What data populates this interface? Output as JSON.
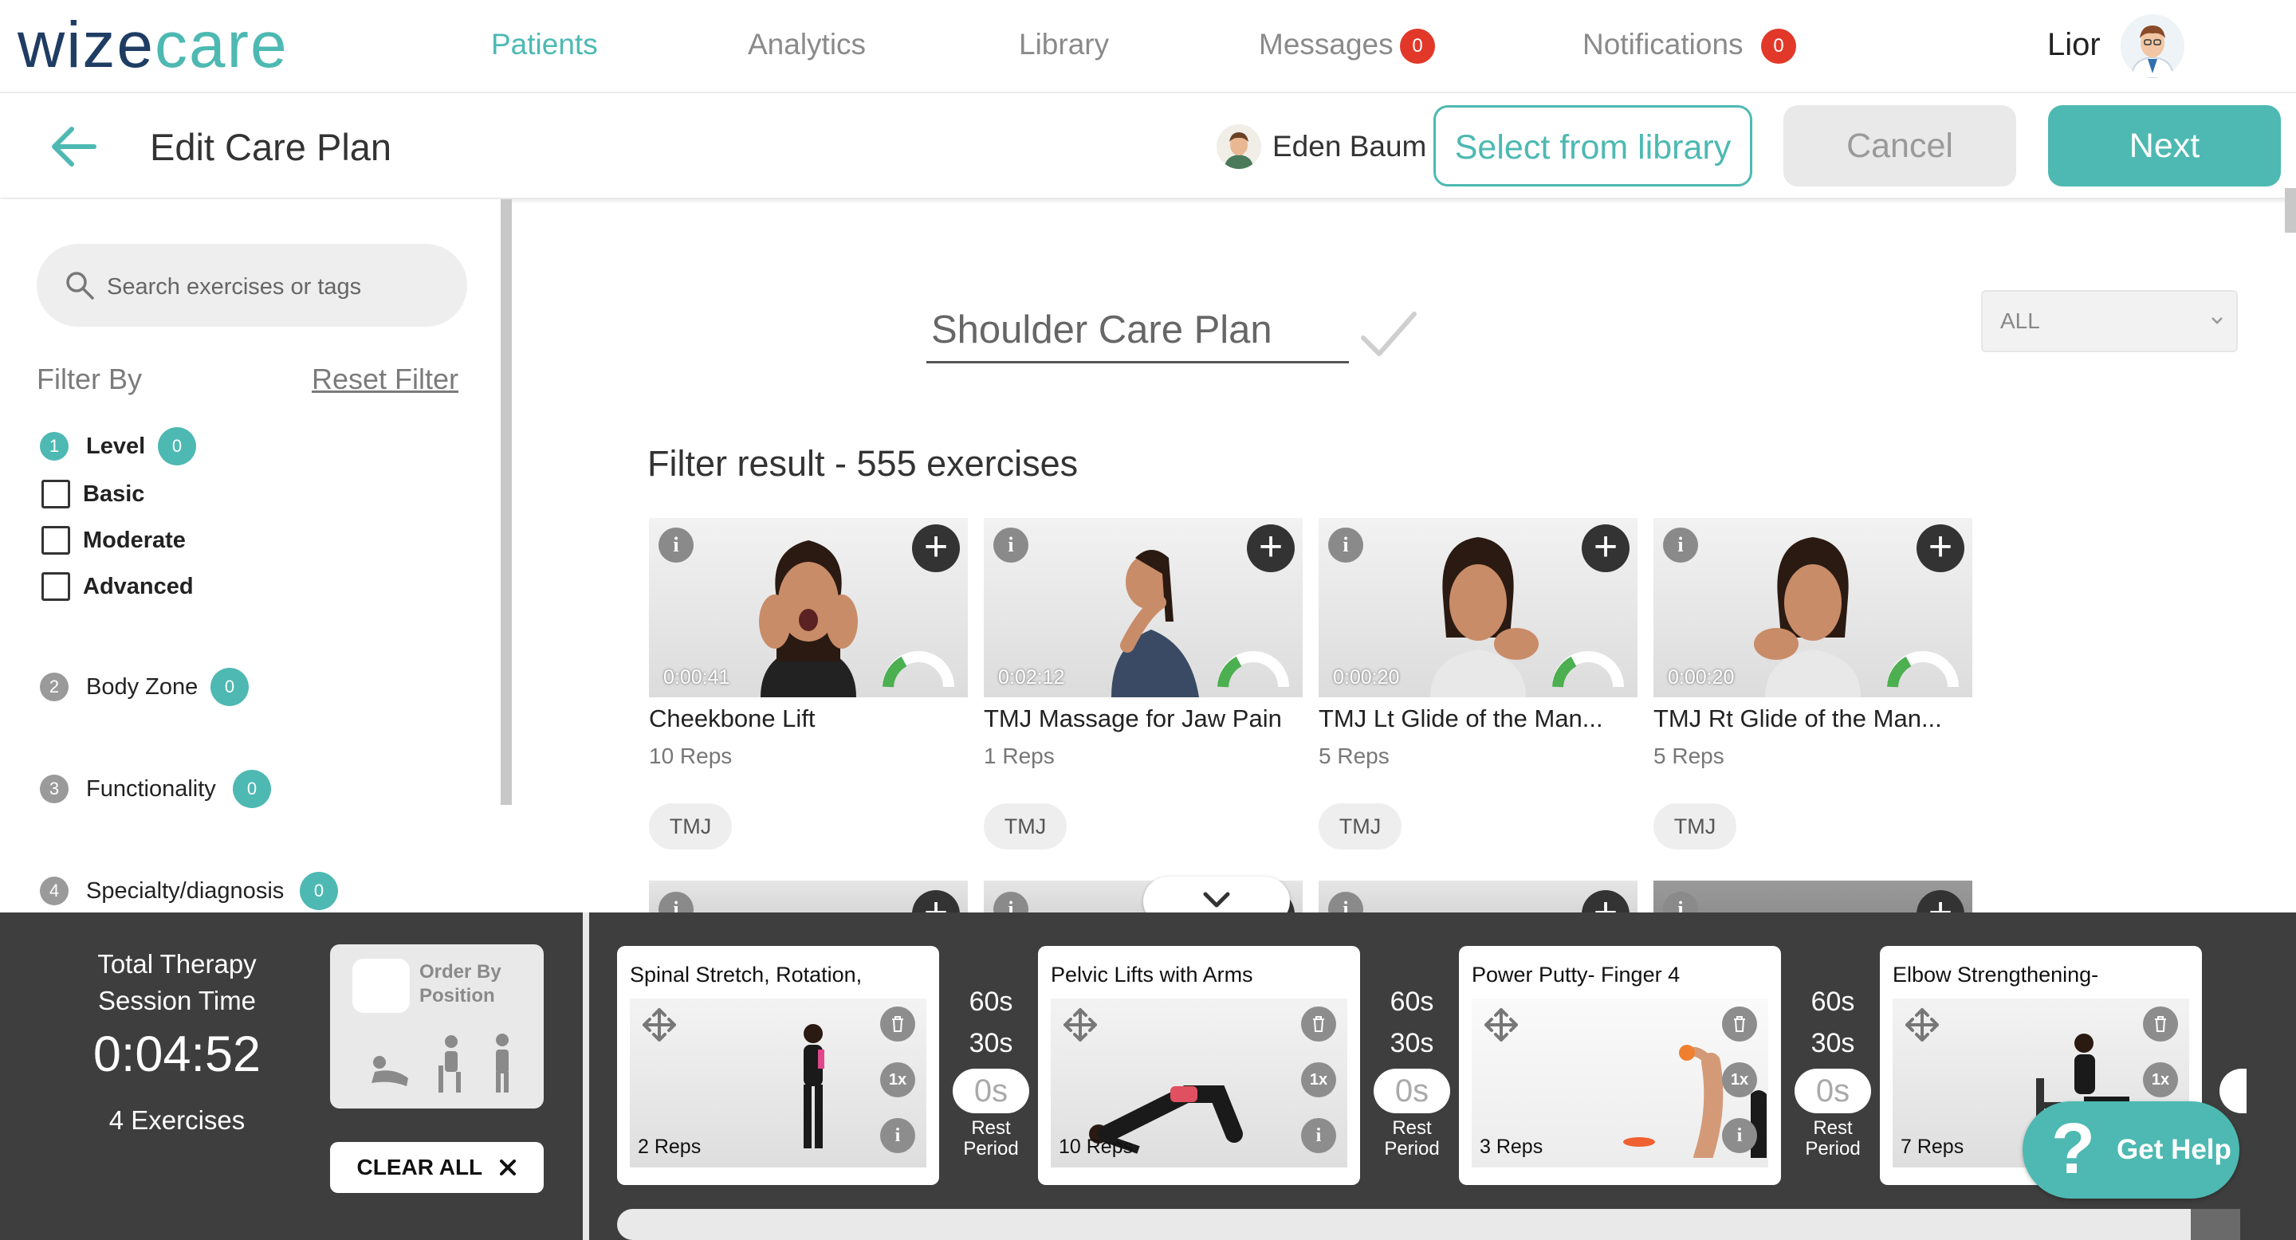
{
  "nav": {
    "logo_part1": "wize",
    "logo_part2": "care",
    "items": [
      {
        "label": "Patients"
      },
      {
        "label": "Analytics"
      },
      {
        "label": "Library"
      },
      {
        "label": "Messages",
        "badge": "0"
      },
      {
        "label": "Notifications",
        "badge": "0"
      }
    ],
    "user_name": "Lior"
  },
  "header": {
    "title": "Edit Care Plan",
    "patient_name": "Eden Baum",
    "select_library_label": "Select from library",
    "cancel_label": "Cancel",
    "next_label": "Next"
  },
  "sidebar": {
    "search_placeholder": "Search exercises or tags",
    "filter_by_label": "Filter By",
    "reset_label": "Reset Filter",
    "filters": [
      {
        "num": "1",
        "label": "Level",
        "count": "0",
        "options": [
          "Basic",
          "Moderate",
          "Advanced"
        ]
      },
      {
        "num": "2",
        "label": "Body Zone",
        "count": "0"
      },
      {
        "num": "3",
        "label": "Functionality",
        "count": "0"
      },
      {
        "num": "4",
        "label": "Specialty/diagnosis",
        "count": "0"
      }
    ]
  },
  "main": {
    "plan_name": "Shoulder Care Plan",
    "level_select_value": "ALL",
    "result_text": "Filter result - 555 exercises",
    "exercises": [
      {
        "title": "Cheekbone Lift",
        "reps": "10 Reps",
        "duration": "0:00:41",
        "tag": "TMJ"
      },
      {
        "title": "TMJ Massage for Jaw Pain",
        "reps": "1 Reps",
        "duration": "0:02:12",
        "tag": "TMJ"
      },
      {
        "title": "TMJ Lt Glide of the Man...",
        "reps": "5 Reps",
        "duration": "0:00:20",
        "tag": "TMJ"
      },
      {
        "title": "TMJ Rt Glide of the Man...",
        "reps": "5 Reps",
        "duration": "0:00:20",
        "tag": "TMJ"
      }
    ]
  },
  "bottom": {
    "total_label": "Total Therapy Session Time",
    "total_time": "0:04:52",
    "exercise_count": "4 Exercises",
    "order_label": "Order By Position",
    "clear_all_label": "CLEAR ALL",
    "plan_items": [
      {
        "title": "Spinal Stretch, Rotation,",
        "reps": "2 Reps",
        "sets": "1x"
      },
      {
        "title": "Pelvic Lifts with Arms",
        "reps": "10 Reps",
        "sets": "1x"
      },
      {
        "title": "Power Putty- Finger 4",
        "reps": "3 Reps",
        "sets": "1x"
      },
      {
        "title": "Elbow Strengthening-",
        "reps": "7 Reps",
        "sets": "1x"
      }
    ],
    "rest": {
      "opt1": "60s",
      "opt2": "30s",
      "selected": "0s",
      "label": "Rest Period"
    },
    "help_label": "Get Help",
    "help_glyph": "?"
  },
  "colors": {
    "accent": "#4db9b2",
    "brand_dark": "#1f3c63",
    "badge": "#e2382a",
    "bottom_bar": "#3e3e3e"
  }
}
